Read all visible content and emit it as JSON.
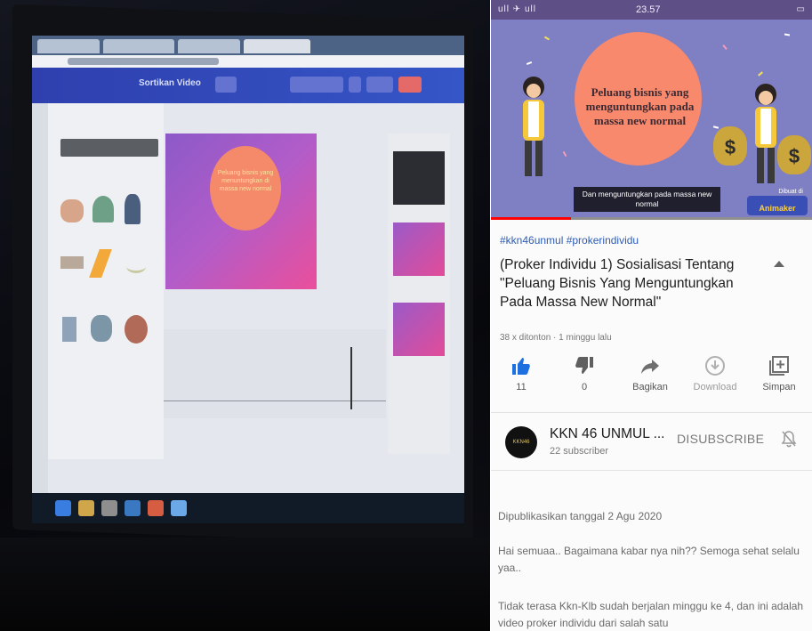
{
  "photo": {
    "app_title": "Sortikan Video",
    "canvas_text": "Peluang bisnis yang menuntungkan di massa new normal"
  },
  "phone": {
    "statusbar": {
      "signal": "ull ✈ ull",
      "time": "23.57",
      "battery": "▭"
    },
    "video": {
      "headline": "Peluang bisnis yang menguntungkan pada massa new normal",
      "caption": "Dan menguntungkan pada massa new normal",
      "watermark_top": "Dibuat di",
      "watermark": "Animaker",
      "bag_symbol": "$",
      "progress_pct": 25
    },
    "hashtags": "#kkn46unmul #prokerindividu",
    "title": "(Proker Individu 1) Sosialisasi Tentang \"Peluang Bisnis Yang Menguntungkan Pada Massa New Normal\"",
    "views": "38 x ditonton · 1 minggu lalu",
    "actions": [
      {
        "label": "11",
        "icon": "thumbs-up-icon"
      },
      {
        "label": "0",
        "icon": "thumbs-down-icon"
      },
      {
        "label": "Bagikan",
        "icon": "share-icon"
      },
      {
        "label": "Download",
        "icon": "download-icon"
      },
      {
        "label": "Simpan",
        "icon": "save-icon"
      }
    ],
    "channel": {
      "name": "KKN 46 UNMUL ...",
      "subscribers": "22 subscriber",
      "unsubscribe_label": "DISUBSCRIBE",
      "avatar_text": "KKN46"
    },
    "published": "Dipublikasikan tanggal 2 Agu 2020",
    "description_1": "Hai semuaa.. Bagaimana kabar nya nih?? Semoga sehat selalu yaa..",
    "description_2": "Tidak terasa Kkn-Klb sudah berjalan minggu ke 4, dan ini adalah video proker individu dari salah satu",
    "colors": {
      "accent_blue": "#2d5bb4",
      "progress_red": "#ff0000",
      "video_bg": "#7f7fc3"
    }
  }
}
